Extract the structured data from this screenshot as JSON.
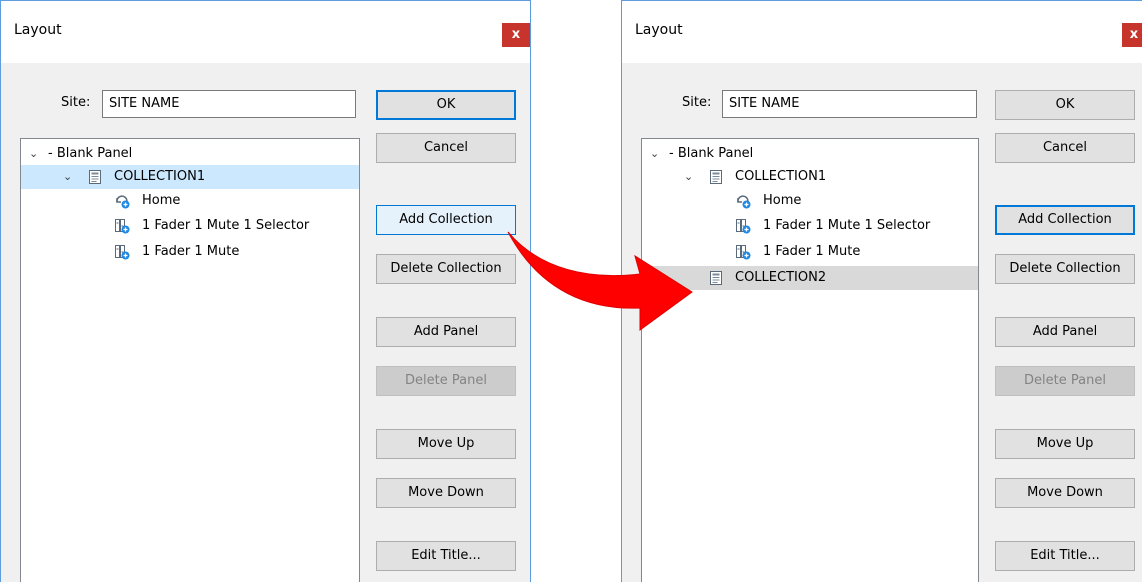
{
  "dialogs": [
    {
      "title": "Layout",
      "close_label": "x",
      "site_label": "Site:",
      "site_value": "SITE NAME",
      "tree": {
        "root": "- Blank Panel",
        "collection1": "COLLECTION1",
        "home": "Home",
        "panel1": "1 Fader 1 Mute 1 Selector",
        "panel2": "1 Fader 1 Mute"
      },
      "buttons": {
        "ok": "OK",
        "cancel": "Cancel",
        "add_collection": "Add Collection",
        "delete_collection": "Delete Collection",
        "add_panel": "Add Panel",
        "delete_panel": "Delete Panel",
        "move_up": "Move Up",
        "move_down": "Move Down",
        "edit_title": "Edit Title..."
      }
    },
    {
      "title": "Layout",
      "close_label": "x",
      "site_label": "Site:",
      "site_value": "SITE NAME",
      "tree": {
        "root": "- Blank Panel",
        "collection1": "COLLECTION1",
        "home": "Home",
        "panel1": "1 Fader 1 Mute 1 Selector",
        "panel2": "1 Fader 1 Mute",
        "collection2": "COLLECTION2"
      },
      "buttons": {
        "ok": "OK",
        "cancel": "Cancel",
        "add_collection": "Add Collection",
        "delete_collection": "Delete Collection",
        "add_panel": "Add Panel",
        "delete_panel": "Delete Panel",
        "move_up": "Move Up",
        "move_down": "Move Down",
        "edit_title": "Edit Title..."
      }
    }
  ],
  "colors": {
    "accent": "#0078d7",
    "close": "#c7342c",
    "selection_focused": "#cce8ff",
    "selection_unfocused": "#d9d9d9",
    "arrow": "#ff0000"
  },
  "icons": {
    "collection": "collection-icon",
    "home": "home-icon",
    "panel": "panel-icon",
    "expand": "chevron-down-icon",
    "arrow": "red-arrow-icon"
  }
}
